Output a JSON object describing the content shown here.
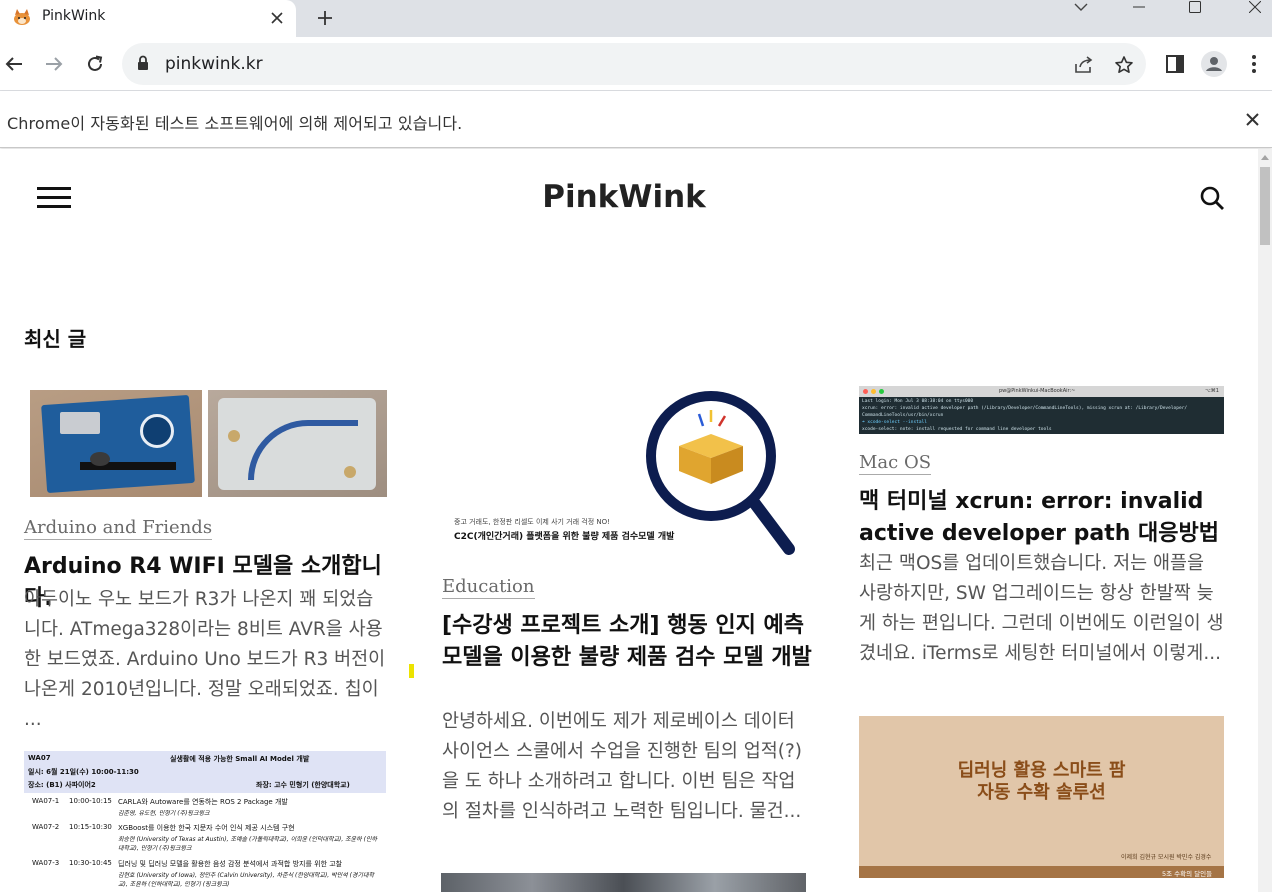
{
  "browser": {
    "tab_title": "PinkWink",
    "url": "pinkwink.kr",
    "automation_notice": "Chrome이 자동화된 테스트 소프트웨어에 의해 제어되고 있습니다."
  },
  "site": {
    "title": "PinkWink",
    "section_heading": "최신 글"
  },
  "posts": [
    {
      "category": "Arduino and Friends",
      "title": "Arduino R4 WIFI 모델을 소개합니다.",
      "excerpt": "아두이노 우노 보드가 R3가 나온지 꽤 되었습니다. ATmega328이라는 8비트 AVR을 사용한 보드였죠. Arduino Uno 보드가 R3 버전이 나온게 2010년입니다. 정말 오래되었죠. 칩이 ..."
    },
    {
      "category": "Education",
      "title": "[수강생 프로젝트 소개] 행동 인지 예측 모델을 이용한 불량 제품 검수 모델 개발",
      "excerpt": "안녕하세요. 이번에도 제가 제로베이스 데이터 사이언스 스쿨에서 수업을 진행한 팀의 업적(?)을 도 하나 소개하려고 합니다. 이번 팀은 작업의 절차를 인식하려고 노력한 팀입니다. 물건..."
    },
    {
      "category": "Mac OS",
      "title": "맥 터미널 xcrun: error: invalid active developer path 대응방법",
      "excerpt": "최근 맥OS를 업데이트했습니다. 저는 애플을 사랑하지만, SW 업그레이드는 항상 한발짝 늦게 하는 편입니다. 그런데 이번에도 이런일이 생겼네요. iTerms로 세팅한 터미널에서 이렇게..."
    }
  ],
  "images": {
    "c2c": {
      "small_caption": "중고 거래도, 한정판 리셀도 이제 사기 거래 걱정 NO!",
      "caption": "C2C(개인간거래) 플랫폼을 위한 불량 제품 검수모델 개발"
    },
    "terminal": {
      "window_title": "pw@PinkWinkui-MacBookAir:~",
      "shortcut": "⌥⌘1",
      "lines": [
        "Last login: Mon Jul  3 08:38:04 on ttys000",
        "xcrun: error: invalid active developer path (/Library/Developer/CommandLineTools), missing xcrun at: /Library/Developer/",
        "CommandLineTools/usr/bin/xcrun",
        "➜  xcode-select --install",
        "xcode-select: note: install requested for command line developer tools"
      ]
    },
    "schedule": {
      "session_code": "WA07",
      "session_title": "실생활에 적용 가능한 Small AI Model 개발",
      "date": "일시: 6월 21일(수) 10:00-11:30",
      "place": "장소: (B1) 사파이어2",
      "chair": "좌장: 고수 민형기 (한양대학교)",
      "rows": [
        {
          "code": "WA07-1",
          "time": "10:00-10:15",
          "title": "CARLA와 Autoware를 연동하는 ROS 2 Package 개발",
          "authors": "김준영, 유도현, 민형기 (주)핑크윙크"
        },
        {
          "code": "WA07-2",
          "time": "10:15-10:30",
          "title": "XGBoost를 이용한 한국 지문자 수어 인식 제공 시스템 구현",
          "authors": "최승현 (University of Texas at Austin), 조예솔 (가톨릭대학교), 이희윤 (인덕대학교), 조윤하 (인하대학교), 민형기 (주)핑크윙크"
        },
        {
          "code": "WA07-3",
          "time": "10:30-10:45",
          "title": "딥러닝 및 딥러닝 모델을 활용한 음성 감정 분석에서 과적합 방지를 위한 고찰",
          "authors": "김현호 (University of Iowa), 정민주 (Calvin University), 차준식 (한양대학교), 박민석 (경기대학교), 조윤하 (인하대학교), 민형기 (핑크윙크)"
        }
      ]
    },
    "banner": {
      "line1": "딥러닝 활용 스마트 팜",
      "line2": "자동 수확 솔루션",
      "credit": "이제희 김현규 모시원 박민수 김경수",
      "footer": "5조 수확의 달인들"
    }
  }
}
